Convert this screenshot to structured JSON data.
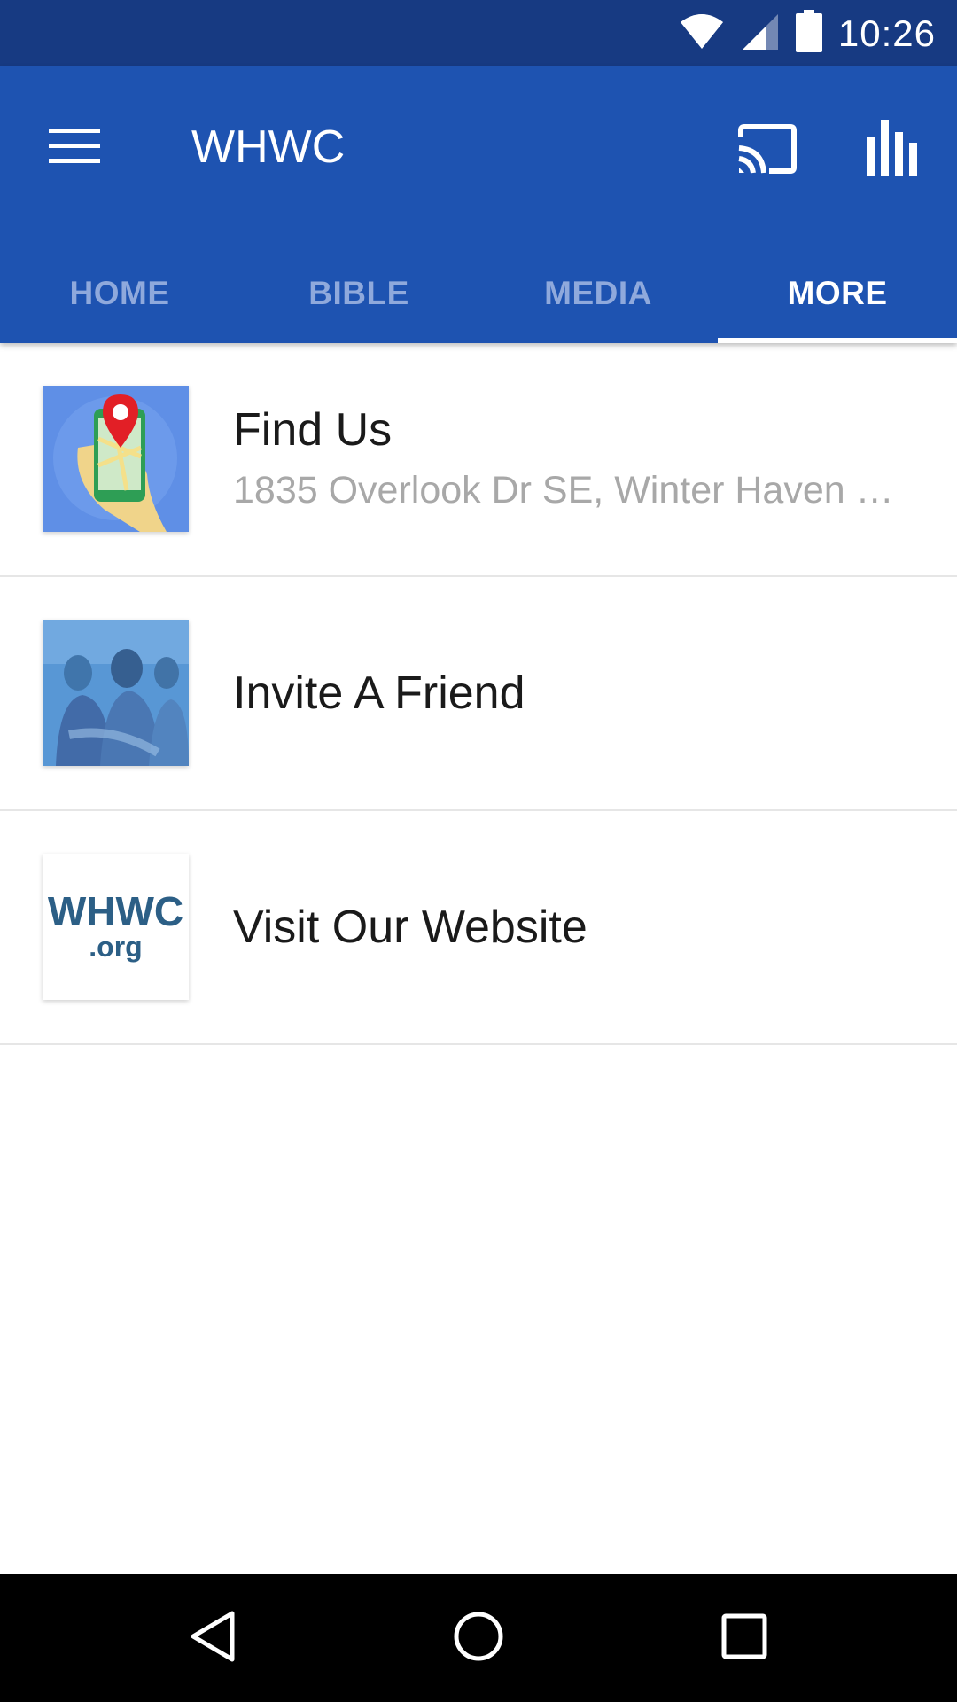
{
  "status_bar": {
    "time": "10:26",
    "icons": [
      "wifi-icon",
      "cell-signal-icon",
      "battery-icon"
    ]
  },
  "app_bar": {
    "title": "WHWC",
    "icons": [
      "menu-icon",
      "cast-icon",
      "bar-chart-icon"
    ],
    "color": "#1e53b1"
  },
  "tabs": [
    {
      "label": "HOME",
      "active": false
    },
    {
      "label": "BIBLE",
      "active": false
    },
    {
      "label": "MEDIA",
      "active": false
    },
    {
      "label": "MORE",
      "active": true
    }
  ],
  "list": {
    "items": [
      {
        "title": "Find Us",
        "subtitle": "1835 Overlook Dr SE, Winter Haven F...",
        "thumbnail": "map-location-phone-icon"
      },
      {
        "title": "Invite A Friend",
        "subtitle": "",
        "thumbnail": "people-photo"
      },
      {
        "title": "Visit Our Website",
        "subtitle": "",
        "thumbnail": "whwc-org-logo",
        "logo_text": "WHWC",
        "logo_subtext": ".org"
      }
    ]
  },
  "nav_bar": {
    "icons": [
      "back-icon",
      "home-icon",
      "recents-icon"
    ]
  }
}
